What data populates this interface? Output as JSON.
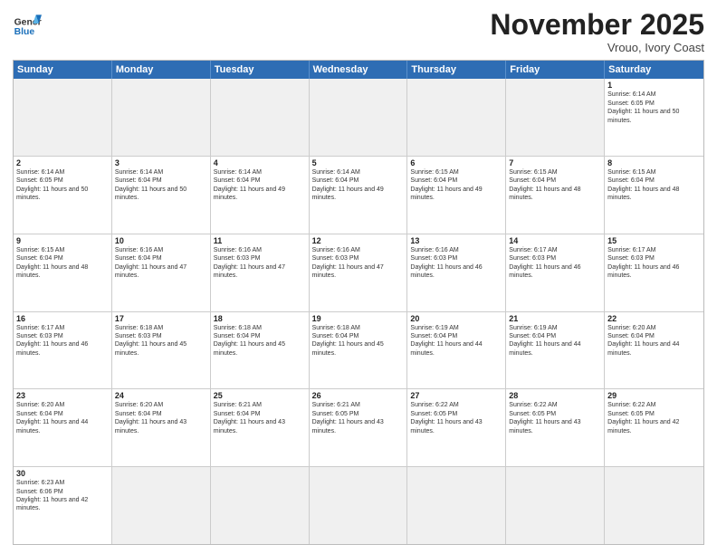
{
  "header": {
    "logo_general": "General",
    "logo_blue": "Blue",
    "month_title": "November 2025",
    "location": "Vrouo, Ivory Coast"
  },
  "weekdays": [
    "Sunday",
    "Monday",
    "Tuesday",
    "Wednesday",
    "Thursday",
    "Friday",
    "Saturday"
  ],
  "weeks": [
    [
      {
        "day": "",
        "empty": true
      },
      {
        "day": "",
        "empty": true
      },
      {
        "day": "",
        "empty": true
      },
      {
        "day": "",
        "empty": true
      },
      {
        "day": "",
        "empty": true
      },
      {
        "day": "",
        "empty": true
      },
      {
        "day": "1",
        "sunrise": "6:14 AM",
        "sunset": "6:05 PM",
        "daylight": "11 hours and 50 minutes."
      }
    ],
    [
      {
        "day": "2",
        "sunrise": "6:14 AM",
        "sunset": "6:05 PM",
        "daylight": "11 hours and 50 minutes."
      },
      {
        "day": "3",
        "sunrise": "6:14 AM",
        "sunset": "6:04 PM",
        "daylight": "11 hours and 50 minutes."
      },
      {
        "day": "4",
        "sunrise": "6:14 AM",
        "sunset": "6:04 PM",
        "daylight": "11 hours and 49 minutes."
      },
      {
        "day": "5",
        "sunrise": "6:14 AM",
        "sunset": "6:04 PM",
        "daylight": "11 hours and 49 minutes."
      },
      {
        "day": "6",
        "sunrise": "6:15 AM",
        "sunset": "6:04 PM",
        "daylight": "11 hours and 49 minutes."
      },
      {
        "day": "7",
        "sunrise": "6:15 AM",
        "sunset": "6:04 PM",
        "daylight": "11 hours and 48 minutes."
      },
      {
        "day": "8",
        "sunrise": "6:15 AM",
        "sunset": "6:04 PM",
        "daylight": "11 hours and 48 minutes."
      }
    ],
    [
      {
        "day": "9",
        "sunrise": "6:15 AM",
        "sunset": "6:04 PM",
        "daylight": "11 hours and 48 minutes."
      },
      {
        "day": "10",
        "sunrise": "6:16 AM",
        "sunset": "6:04 PM",
        "daylight": "11 hours and 47 minutes."
      },
      {
        "day": "11",
        "sunrise": "6:16 AM",
        "sunset": "6:03 PM",
        "daylight": "11 hours and 47 minutes."
      },
      {
        "day": "12",
        "sunrise": "6:16 AM",
        "sunset": "6:03 PM",
        "daylight": "11 hours and 47 minutes."
      },
      {
        "day": "13",
        "sunrise": "6:16 AM",
        "sunset": "6:03 PM",
        "daylight": "11 hours and 46 minutes."
      },
      {
        "day": "14",
        "sunrise": "6:17 AM",
        "sunset": "6:03 PM",
        "daylight": "11 hours and 46 minutes."
      },
      {
        "day": "15",
        "sunrise": "6:17 AM",
        "sunset": "6:03 PM",
        "daylight": "11 hours and 46 minutes."
      }
    ],
    [
      {
        "day": "16",
        "sunrise": "6:17 AM",
        "sunset": "6:03 PM",
        "daylight": "11 hours and 46 minutes."
      },
      {
        "day": "17",
        "sunrise": "6:18 AM",
        "sunset": "6:03 PM",
        "daylight": "11 hours and 45 minutes."
      },
      {
        "day": "18",
        "sunrise": "6:18 AM",
        "sunset": "6:04 PM",
        "daylight": "11 hours and 45 minutes."
      },
      {
        "day": "19",
        "sunrise": "6:18 AM",
        "sunset": "6:04 PM",
        "daylight": "11 hours and 45 minutes."
      },
      {
        "day": "20",
        "sunrise": "6:19 AM",
        "sunset": "6:04 PM",
        "daylight": "11 hours and 44 minutes."
      },
      {
        "day": "21",
        "sunrise": "6:19 AM",
        "sunset": "6:04 PM",
        "daylight": "11 hours and 44 minutes."
      },
      {
        "day": "22",
        "sunrise": "6:20 AM",
        "sunset": "6:04 PM",
        "daylight": "11 hours and 44 minutes."
      }
    ],
    [
      {
        "day": "23",
        "sunrise": "6:20 AM",
        "sunset": "6:04 PM",
        "daylight": "11 hours and 44 minutes."
      },
      {
        "day": "24",
        "sunrise": "6:20 AM",
        "sunset": "6:04 PM",
        "daylight": "11 hours and 43 minutes."
      },
      {
        "day": "25",
        "sunrise": "6:21 AM",
        "sunset": "6:04 PM",
        "daylight": "11 hours and 43 minutes."
      },
      {
        "day": "26",
        "sunrise": "6:21 AM",
        "sunset": "6:05 PM",
        "daylight": "11 hours and 43 minutes."
      },
      {
        "day": "27",
        "sunrise": "6:22 AM",
        "sunset": "6:05 PM",
        "daylight": "11 hours and 43 minutes."
      },
      {
        "day": "28",
        "sunrise": "6:22 AM",
        "sunset": "6:05 PM",
        "daylight": "11 hours and 43 minutes."
      },
      {
        "day": "29",
        "sunrise": "6:22 AM",
        "sunset": "6:05 PM",
        "daylight": "11 hours and 42 minutes."
      }
    ],
    [
      {
        "day": "30",
        "sunrise": "6:23 AM",
        "sunset": "6:06 PM",
        "daylight": "11 hours and 42 minutes."
      },
      {
        "day": "",
        "empty": true
      },
      {
        "day": "",
        "empty": true
      },
      {
        "day": "",
        "empty": true
      },
      {
        "day": "",
        "empty": true
      },
      {
        "day": "",
        "empty": true
      },
      {
        "day": "",
        "empty": true
      }
    ]
  ],
  "labels": {
    "sunrise": "Sunrise:",
    "sunset": "Sunset:",
    "daylight": "Daylight:"
  }
}
